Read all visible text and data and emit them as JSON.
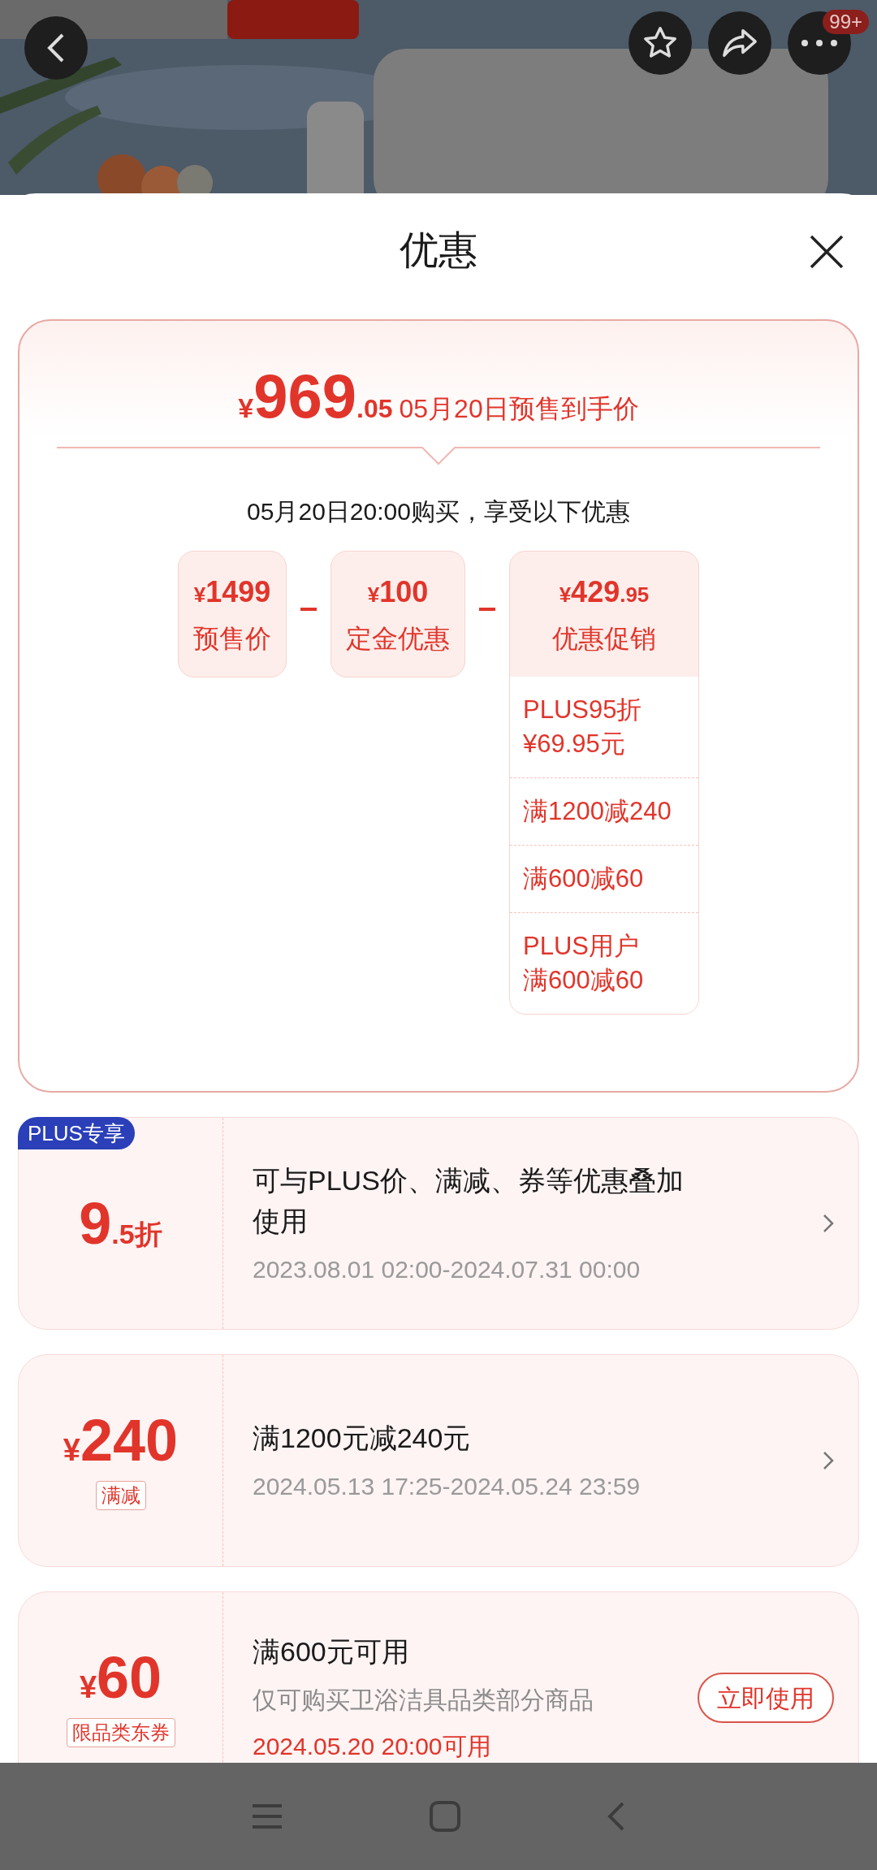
{
  "header": {
    "more_badge": "99+"
  },
  "sheet": {
    "title": "优惠"
  },
  "summary": {
    "currency": "¥",
    "price_int": "969",
    "price_dec": ".05",
    "price_label": "05月20日预售到手价",
    "subtitle": "05月20日20:00购买，享受以下优惠",
    "terms": [
      {
        "currency": "¥",
        "integer": "1499",
        "label": "预售价"
      },
      {
        "currency": "¥",
        "integer": "100",
        "label": "定金优惠"
      },
      {
        "currency": "¥",
        "integer": "429",
        "decimal": ".95",
        "label": "优惠促销",
        "details": [
          [
            "PLUS95折",
            "¥69.95元"
          ],
          [
            "满1200减240"
          ],
          [
            "满600减60"
          ],
          [
            "PLUS用户",
            "满600减60"
          ]
        ]
      }
    ]
  },
  "coupons": [
    {
      "kind": "discount",
      "badge": "PLUS专享",
      "value": "9",
      "value_suffix": ".5折",
      "title": "可与PLUS价、满减、券等优惠叠加使用",
      "validity": "2023.08.01 02:00-2024.07.31 00:00",
      "upcoming": false
    },
    {
      "kind": "amount",
      "currency": "¥",
      "value": "240",
      "tag": "满减",
      "title": "满1200元减240元",
      "validity": "2024.05.13 17:25-2024.05.24 23:59",
      "upcoming": false
    },
    {
      "kind": "amount",
      "currency": "¥",
      "value": "60",
      "tag": "限品类东券",
      "title": "满600元可用",
      "note": "仅可购买卫浴洁具品类部分商品",
      "validity": "2024.05.20 20:00可用",
      "upcoming": true,
      "button": "立即使用"
    }
  ]
}
